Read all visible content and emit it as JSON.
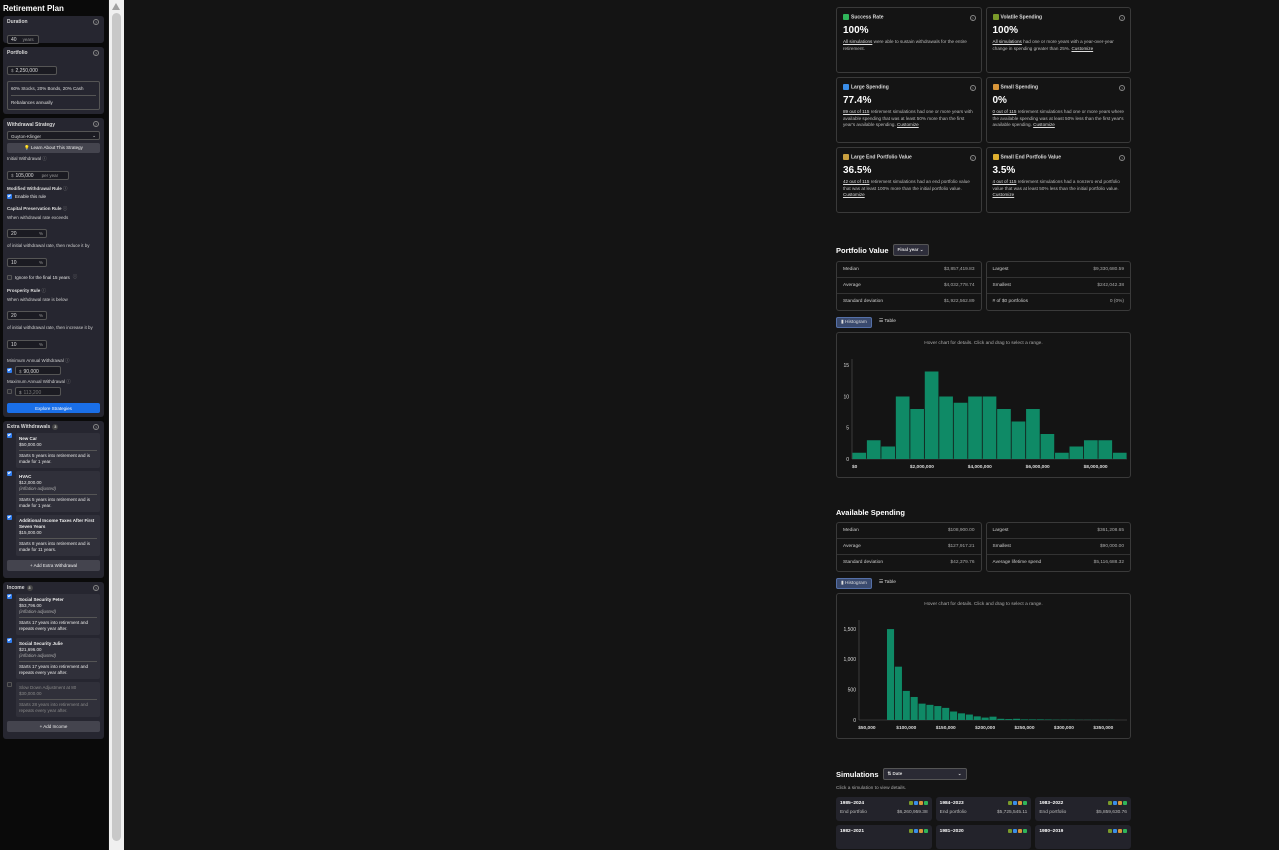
{
  "sidebar": {
    "title": "Retirement Plan",
    "duration": {
      "title": "Duration",
      "value": "40",
      "suffix": "years"
    },
    "portfolio": {
      "title": "Portfolio",
      "currency": "$",
      "value": "2,250,000",
      "allocation": "60% Stocks, 20% Bonds, 20% Cash",
      "rebalance": "Rebalances annually"
    },
    "withdrawal": {
      "title": "Withdrawal Strategy",
      "strategy": "Guyton-Klinger",
      "learn_label": "Learn About This Strategy",
      "initial_label": "Initial Withdrawal",
      "initial_currency": "$",
      "initial_value": "105,000",
      "initial_suffix": "per year",
      "modified_rule_label": "Modified Withdrawal Rule",
      "enable_label": "Enable this rule",
      "capital_label": "Capital Preservation Rule",
      "capital_when": "When withdrawal rate exceeds",
      "capital_pct": "20",
      "capital_then": "of initial withdrawal rate, then reduce it by",
      "capital_reduce": "10",
      "ignore_label": "Ignore for the final 15 years",
      "prosperity_label": "Prosperity Rule",
      "prosperity_when": "When withdrawal rate is below",
      "prosperity_pct": "20",
      "prosperity_then": "of initial withdrawal rate, then increase it by",
      "prosperity_increase": "10",
      "pct": "%",
      "min_label": "Minimum Annual Withdrawal",
      "min_value": "90,000",
      "max_label": "Maximum Annual Withdrawal",
      "max_value": "113,200",
      "explore_label": "Explore Strategies"
    },
    "extra": {
      "title": "Extra Withdrawals",
      "count": "3",
      "items": [
        {
          "name": "New Car",
          "amount": "$50,000.00",
          "note": "",
          "desc": "Starts 5 years into retirement and is made for 1 year."
        },
        {
          "name": "HVAC",
          "amount": "$12,000.00",
          "note": "(inflation-adjusted)",
          "desc": "Starts 5 years into retirement and is made for 1 year."
        },
        {
          "name": "Additional Income Taxes After First Seven Years",
          "amount": "$15,000.00",
          "note": "",
          "desc": "Starts 8 years into retirement and is made for 11 years."
        }
      ],
      "add_label": "+ Add Extra Withdrawal"
    },
    "income": {
      "title": "Income",
      "count": "3",
      "items": [
        {
          "name": "Social Security Peter",
          "amount": "$53,796.00",
          "note": "(inflation-adjusted)",
          "desc": "Starts 17 years into retirement and repeats every year after."
        },
        {
          "name": "Social Security Julie",
          "amount": "$21,696.00",
          "note": "(inflation-adjusted)",
          "desc": "Starts 17 years into retirement and repeats every year after."
        },
        {
          "name": "Slow Down Adjustment at 80",
          "amount": "$30,000.00",
          "note": "",
          "desc": "Starts 28 years into retirement and repeats every year after."
        }
      ],
      "add_label": "+ Add Income"
    }
  },
  "stats": [
    {
      "title": "Success Rate",
      "value": "100%",
      "link": "All simulations",
      "text": " were able to sustain withdrawals for the entire retirement.",
      "customize": "",
      "color": "#2fb55a"
    },
    {
      "title": "Volatile Spending",
      "value": "100%",
      "link": "All simulations",
      "text": " had one or more years with a year-over-year change in spending greater than 25%.",
      "customize": "Customize",
      "color": "#7a9a2a"
    },
    {
      "title": "Large Spending",
      "value": "77.4%",
      "link": "89 out of 115",
      "text": " retirement simulations had one or more years with available spending that was at least 50% more than the first year's available spending.",
      "customize": "Customize",
      "color": "#3a8de8"
    },
    {
      "title": "Small Spending",
      "value": "0%",
      "link": "0 out of 115",
      "text": " retirement simulations had one or more years where the available spending was at least 50% less than the first year's available spending.",
      "customize": "Customize",
      "color": "#d9963a"
    },
    {
      "title": "Large End Portfolio Value",
      "value": "36.5%",
      "link": "42 out of 115",
      "text": " retirement simulations had an end portfolio value that was at least 100% more than the initial portfolio value.",
      "customize": "Customize",
      "color": "#c9a040"
    },
    {
      "title": "Small End Portfolio Value",
      "value": "3.5%",
      "link": "4 out of 115",
      "text": " retirement simulations had a nonzero end portfolio value that was at least 50% less than the initial portfolio value.",
      "customize": "Customize",
      "color": "#e0b030"
    }
  ],
  "portfolio_value": {
    "title": "Portfolio Value",
    "selector": "Final year",
    "left": [
      {
        "k": "Median",
        "v": "$3,857,419.83"
      },
      {
        "k": "Average",
        "v": "$4,032,778.74"
      },
      {
        "k": "Standard deviation",
        "v": "$1,922,562.89"
      }
    ],
    "right": [
      {
        "k": "Largest",
        "v": "$9,330,680.59"
      },
      {
        "k": "Smallest",
        "v": "$242,042.38"
      },
      {
        "k": "# of $0 portfolios",
        "v": "0 (0%)"
      }
    ]
  },
  "available_spending": {
    "title": "Available Spending",
    "left": [
      {
        "k": "Median",
        "v": "$108,900.00"
      },
      {
        "k": "Average",
        "v": "$127,917.21"
      },
      {
        "k": "Standard deviation",
        "v": "$42,379.76"
      }
    ],
    "right": [
      {
        "k": "Largest",
        "v": "$361,208.65"
      },
      {
        "k": "Smallest",
        "v": "$90,000.00"
      },
      {
        "k": "Average lifetime spend",
        "v": "$5,116,688.32"
      }
    ]
  },
  "tabs": {
    "histogram": "Histogram",
    "table": "Table"
  },
  "hint": "Hover chart for details. Click and drag to select a range.",
  "chart_data": [
    {
      "type": "bar",
      "bar_color": "#0f8a66",
      "x": [
        250000,
        750000,
        1250000,
        1750000,
        2250000,
        2750000,
        3250000,
        3750000,
        4250000,
        4750000,
        5250000,
        5750000,
        6250000,
        6750000,
        7250000,
        7750000,
        8250000,
        8750000,
        9250000
      ],
      "values": [
        1,
        3,
        2,
        10,
        8,
        14,
        10,
        9,
        10,
        10,
        8,
        6,
        8,
        4,
        1,
        2,
        3,
        3,
        1
      ],
      "xticks": [
        "$0",
        "$2,000,000",
        "$4,000,000",
        "$6,000,000",
        "$8,000,000"
      ],
      "xtick_values": [
        0,
        2000000,
        4000000,
        6000000,
        8000000
      ],
      "yticks": [
        0,
        5,
        10,
        15
      ],
      "xlim": [
        0,
        9500000
      ],
      "ylim": [
        0,
        16
      ]
    },
    {
      "type": "bar",
      "bar_color": "#0f8a66",
      "x": [
        80000,
        90000,
        100000,
        110000,
        120000,
        130000,
        140000,
        150000,
        160000,
        170000,
        180000,
        190000,
        200000,
        210000,
        220000,
        230000,
        240000,
        250000,
        260000,
        270000,
        280000,
        290000,
        300000,
        310000,
        320000,
        330000,
        340000,
        350000,
        360000
      ],
      "values": [
        1500,
        880,
        480,
        380,
        270,
        250,
        230,
        200,
        140,
        110,
        90,
        60,
        40,
        55,
        20,
        15,
        20,
        10,
        10,
        10,
        8,
        5,
        5,
        5,
        3,
        3,
        2,
        2,
        2
      ],
      "xticks": [
        "$50,000",
        "$100,000",
        "$150,000",
        "$200,000",
        "$250,000",
        "$300,000",
        "$350,000"
      ],
      "xtick_values": [
        50000,
        100000,
        150000,
        200000,
        250000,
        300000,
        350000
      ],
      "yticks": [
        "0",
        "500",
        "1,000",
        "1,500"
      ],
      "ytick_values": [
        0,
        500,
        1000,
        1500
      ],
      "xlim": [
        40000,
        380000
      ],
      "ylim": [
        0,
        1650
      ]
    }
  ],
  "simulations": {
    "title": "Simulations",
    "sort": "Date",
    "subtitle": "Click a simulation to view details.",
    "end_label": "End portfolio",
    "items": [
      {
        "years": "1985–2024",
        "end": "$6,260,959.38"
      },
      {
        "years": "1984–2023",
        "end": "$5,725,545.11"
      },
      {
        "years": "1983–2022",
        "end": "$5,859,630.76"
      },
      {
        "years": "1982–2021",
        "end": ""
      },
      {
        "years": "1981–2020",
        "end": ""
      },
      {
        "years": "1980–2019",
        "end": ""
      }
    ],
    "dot_colors": [
      "#7a9a2a",
      "#3a8de8",
      "#d9963a",
      "#2fb55a"
    ]
  }
}
